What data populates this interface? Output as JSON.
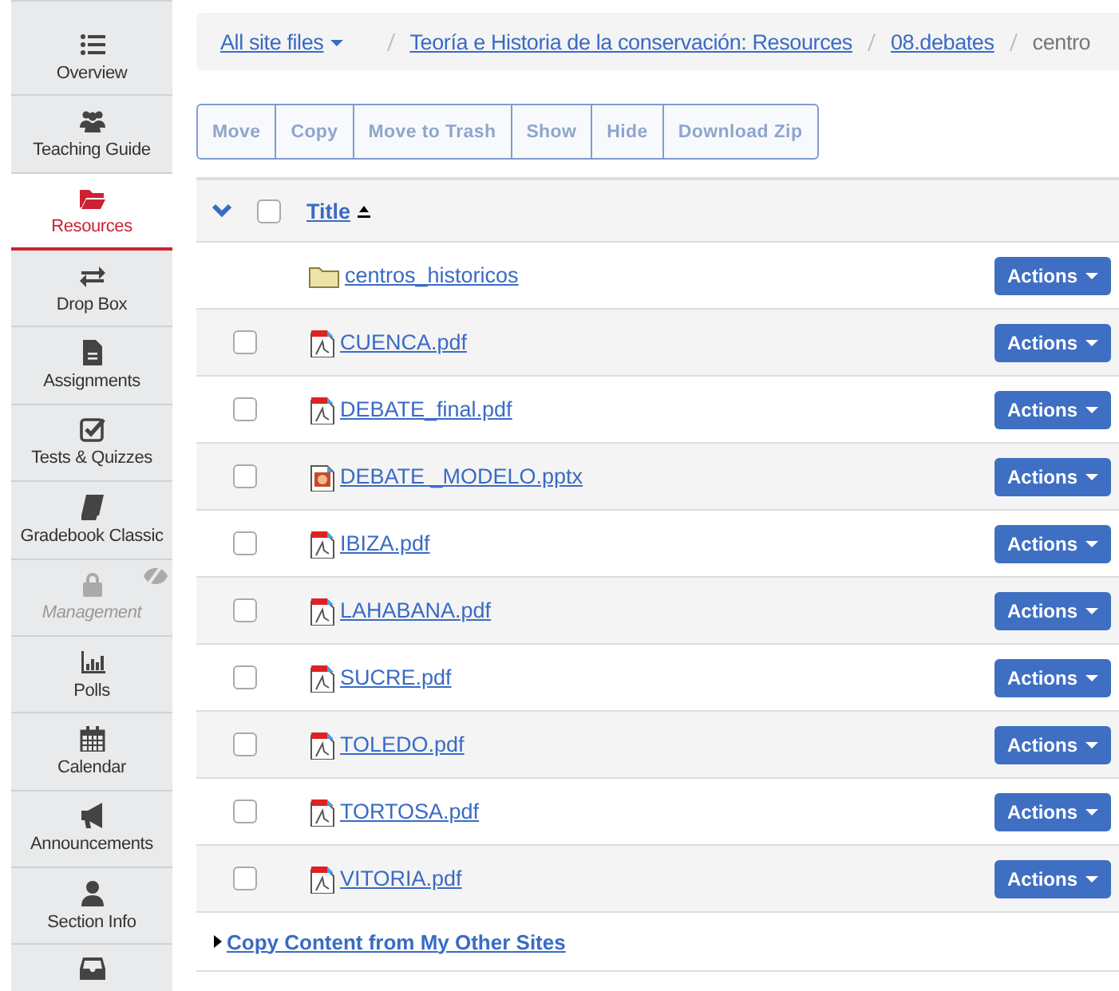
{
  "sidebar": {
    "items": [
      {
        "label": "Overview",
        "selected": false,
        "hidden": false
      },
      {
        "label": "Teaching Guide",
        "selected": false,
        "hidden": false
      },
      {
        "label": "Resources",
        "selected": true,
        "hidden": false
      },
      {
        "label": "Drop Box",
        "selected": false,
        "hidden": false
      },
      {
        "label": "Assignments",
        "selected": false,
        "hidden": false
      },
      {
        "label": "Tests & Quizzes",
        "selected": false,
        "hidden": false
      },
      {
        "label": "Gradebook Classic",
        "selected": false,
        "hidden": false
      },
      {
        "label": "Management",
        "selected": false,
        "hidden": true
      },
      {
        "label": "Polls",
        "selected": false,
        "hidden": false
      },
      {
        "label": "Calendar",
        "selected": false,
        "hidden": false
      },
      {
        "label": "Announcements",
        "selected": false,
        "hidden": false
      },
      {
        "label": "Section Info",
        "selected": false,
        "hidden": false
      }
    ]
  },
  "breadcrumb": {
    "dropdown": "All site files",
    "links": [
      "Teoría e Historia de la conservación: Resources",
      "08.debates"
    ],
    "current": "centro"
  },
  "toolbar": [
    "Move",
    "Copy",
    "Move to Trash",
    "Show",
    "Hide",
    "Download Zip"
  ],
  "table": {
    "header": {
      "title": "Title",
      "checked": false
    },
    "rows": [
      {
        "kind": "folder",
        "name": "centros_historicos",
        "action": "Actions"
      },
      {
        "kind": "pdf",
        "name": "CUENCA.pdf",
        "checked": false,
        "action": "Actions"
      },
      {
        "kind": "pdf",
        "name": "DEBATE_final.pdf",
        "checked": false,
        "action": "Actions"
      },
      {
        "kind": "pptx",
        "name": "DEBATE _MODELO.pptx",
        "checked": false,
        "action": "Actions"
      },
      {
        "kind": "pdf",
        "name": "IBIZA.pdf",
        "checked": false,
        "action": "Actions"
      },
      {
        "kind": "pdf",
        "name": "LAHABANA.pdf",
        "checked": false,
        "action": "Actions"
      },
      {
        "kind": "pdf",
        "name": "SUCRE.pdf",
        "checked": false,
        "action": "Actions"
      },
      {
        "kind": "pdf",
        "name": "TOLEDO.pdf",
        "checked": false,
        "action": "Actions"
      },
      {
        "kind": "pdf",
        "name": "TORTOSA.pdf",
        "checked": false,
        "action": "Actions"
      },
      {
        "kind": "pdf",
        "name": "VITORIA.pdf",
        "checked": false,
        "action": "Actions"
      }
    ]
  },
  "footer_link": "Copy Content from My Other Sites"
}
